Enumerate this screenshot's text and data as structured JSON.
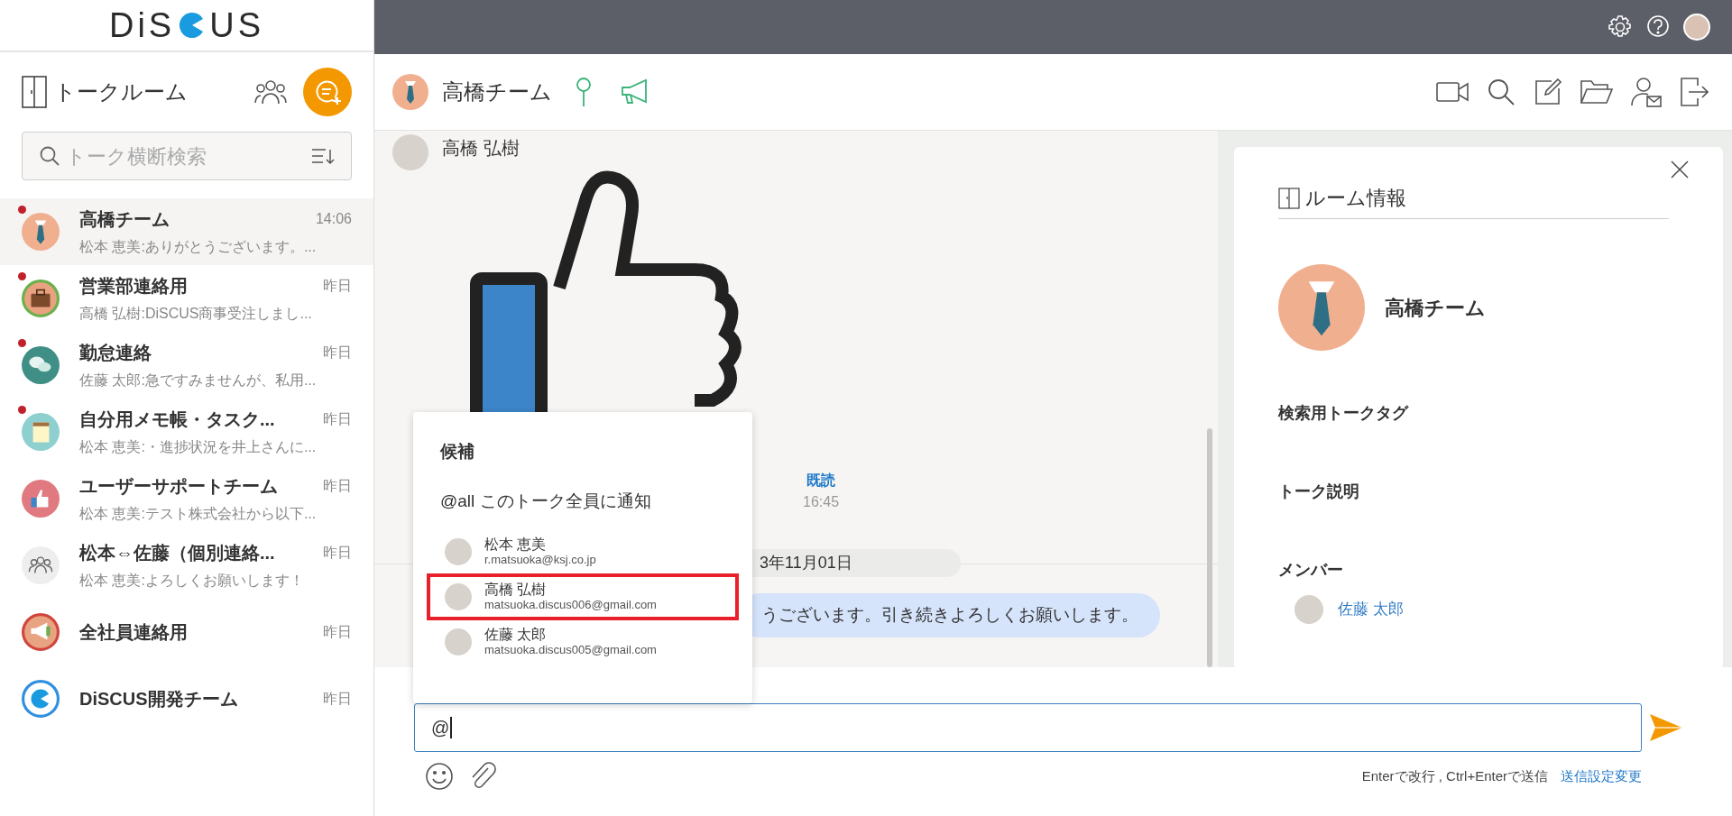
{
  "logo": {
    "before": "DiS",
    "after": "US"
  },
  "sidebar": {
    "title": "トークルーム",
    "search": {
      "placeholder": "トーク横断検索"
    },
    "rooms": [
      {
        "title": "高橋チーム",
        "time": "14:06",
        "preview": "松本 恵美:ありがとうございます。...",
        "unread": true,
        "selected": true,
        "kind": "tie",
        "color": "#f0b08f"
      },
      {
        "title": "営業部連絡用",
        "time": "昨日",
        "preview": "高橋 弘樹:DiSCUS商事受注しまし...",
        "unread": true,
        "selected": false,
        "kind": "briefcase",
        "color": "#e9a27f"
      },
      {
        "title": "勤怠連絡",
        "time": "昨日",
        "preview": "佐藤 太郎:急ですみませんが、私用...",
        "unread": true,
        "selected": false,
        "kind": "chat",
        "color": "#3f8f86"
      },
      {
        "title": "自分用メモ帳・タスク...",
        "time": "昨日",
        "preview": "松本 恵美:・進捗状況を井上さんに...",
        "unread": true,
        "selected": false,
        "kind": "notepad",
        "color": "#8ecfd0"
      },
      {
        "title": "ユーザーサポートチーム",
        "time": "昨日",
        "preview": "松本 恵美:テスト株式会社から以下...",
        "unread": false,
        "selected": false,
        "kind": "thumb",
        "color": "#e07a80"
      },
      {
        "title": "松本⇔佐藤（個別連絡...",
        "time": "昨日",
        "preview": "松本 恵美:よろしくお願いします！",
        "unread": false,
        "selected": false,
        "kind": "people",
        "color": "#eeeeee"
      },
      {
        "title": "全社員連絡用",
        "time": "昨日",
        "unread": false,
        "selected": false,
        "kind": "megaphone",
        "color": "#e8a382"
      },
      {
        "title": "DiSCUS開発チーム",
        "time": "昨日",
        "unread": false,
        "selected": false,
        "kind": "logo",
        "color": "#2f8fe0"
      }
    ]
  },
  "room_header": {
    "title": "高橋チーム"
  },
  "chat": {
    "sender": "高橋 弘樹",
    "read_label": "既読",
    "read_time": "16:45",
    "date": "3年11月01日",
    "message": "うございます。引き続きよろしくお願いします。"
  },
  "mention_popup": {
    "title": "候補",
    "all_option": "@all このトーク全員に通知",
    "candidates": [
      {
        "name": "松本 恵美",
        "email": "r.matsuoka@ksj.co.jp",
        "selected": false
      },
      {
        "name": "高橋 弘樹",
        "email": "matsuoka.discus006@gmail.com",
        "selected": true
      },
      {
        "name": "佐藤 太郎",
        "email": "matsuoka.discus005@gmail.com",
        "selected": false
      }
    ]
  },
  "room_info": {
    "title": "ルーム情報",
    "room_name": "高橋チーム",
    "sections": [
      "検索用トークタグ",
      "トーク説明",
      "メンバー"
    ],
    "members": [
      {
        "name": "佐藤 太郎"
      }
    ]
  },
  "composer": {
    "value": "@",
    "hint": "Enterで改行 , Ctrl+Enterで送信",
    "settings_link": "送信設定変更"
  }
}
